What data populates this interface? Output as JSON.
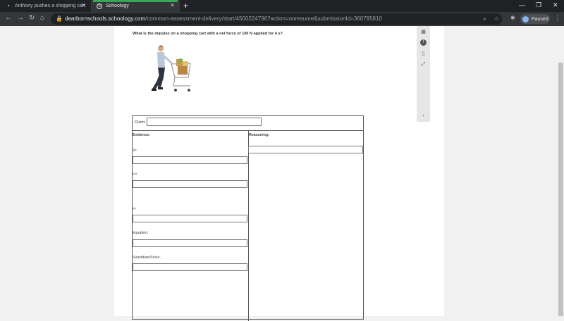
{
  "browser": {
    "tabs": [
      {
        "title": "Anthony pushes a shopping cart",
        "active": false
      },
      {
        "title": "Schoology",
        "active": true
      }
    ],
    "url_domain": "dearbornschools.schoology.com",
    "url_path": "/common-assessment-delivery/start/4500224796?action=onresume&submissionId=360795810",
    "profile_label": "Paused",
    "colors": {
      "tab_strip": "#202124",
      "active_tab": "#35363a",
      "progress": "#34a853",
      "profile": "#8ab4f8"
    }
  },
  "question": {
    "text": "What is the impulse on a shopping cart with a net force of 100 N applied  for  4 s?"
  },
  "tools": [
    {
      "icon": "calculator-icon"
    },
    {
      "icon": "info-icon"
    },
    {
      "icon": "device-icon"
    },
    {
      "icon": "fullscreen-icon"
    },
    {
      "icon": "collapse-chevron-icon"
    }
  ],
  "form": {
    "claim_label": "Claim:",
    "evidence_label": "Evidence:",
    "reasoning_label": "Reasoning:",
    "fields": [
      {
        "label": "J=",
        "value": ""
      },
      {
        "label": "F=",
        "value": ""
      },
      {
        "label": "t=",
        "value": ""
      },
      {
        "label": "Equation:",
        "value": ""
      },
      {
        "label": "Substitute/Solve:",
        "value": ""
      }
    ],
    "claim_value": "",
    "reasoning_value": ""
  }
}
